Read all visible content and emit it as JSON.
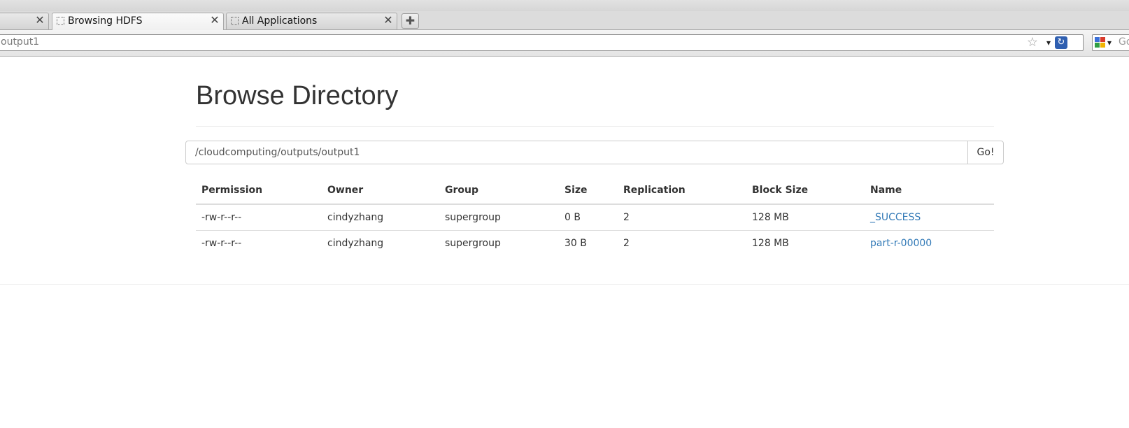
{
  "browser": {
    "tabs": [
      {
        "title": "",
        "active": false
      },
      {
        "title": "Browsing HDFS",
        "active": true
      },
      {
        "title": "All Applications",
        "active": false
      }
    ],
    "address": "output1",
    "search_placeholder": "Go",
    "icons": {
      "tab_close": "close-icon",
      "new_tab": "plus-icon",
      "bookmark": "star-icon",
      "reload": "reload-icon",
      "search_engine": "google-icon"
    }
  },
  "page": {
    "title": "Browse Directory",
    "path_value": "/cloudcomputing/outputs/output1",
    "go_label": "Go!",
    "link_color": "#337ab7",
    "table": {
      "headers": [
        "Permission",
        "Owner",
        "Group",
        "Size",
        "Replication",
        "Block Size",
        "Name"
      ],
      "rows": [
        {
          "permission": "-rw-r--r--",
          "owner": "cindyzhang",
          "group": "supergroup",
          "size": "0 B",
          "replication": "2",
          "block_size": "128 MB",
          "name": "_SUCCESS"
        },
        {
          "permission": "-rw-r--r--",
          "owner": "cindyzhang",
          "group": "supergroup",
          "size": "30 B",
          "replication": "2",
          "block_size": "128 MB",
          "name": "part-r-00000"
        }
      ]
    }
  }
}
